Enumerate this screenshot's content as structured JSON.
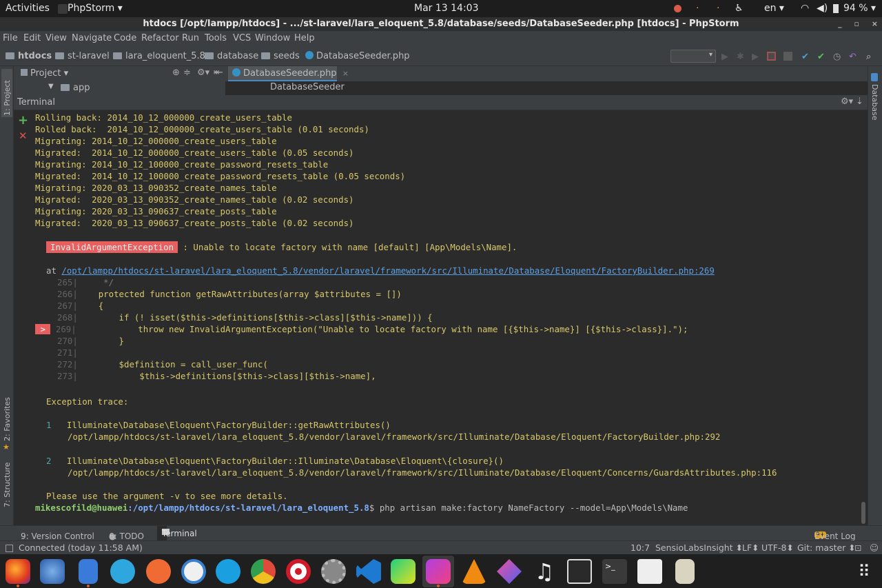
{
  "topbar": {
    "activities": "Activities",
    "app_menu": "PhpStorm ▾",
    "clock": "Mar 13  14:03",
    "lang": "en ▾",
    "battery": "94 % ▾"
  },
  "window": {
    "title": "htdocs [/opt/lampp/htdocs] - .../st-laravel/lara_eloquent_5.8/database/seeds/DatabaseSeeder.php [htdocs] - PhpStorm",
    "min": "_",
    "max": "▫",
    "close": "×"
  },
  "menu": [
    "File",
    "Edit",
    "View",
    "Navigate",
    "Code",
    "Refactor",
    "Run",
    "Tools",
    "VCS",
    "Window",
    "Help"
  ],
  "breadcrumb": [
    "htdocs",
    "st-laravel",
    "lara_eloquent_5.8",
    "database",
    "seeds",
    "DatabaseSeeder.php"
  ],
  "left_strip": {
    "project": "1: Project",
    "favorites": "2: Favorites",
    "structure": "7: Structure"
  },
  "right_strip": {
    "database": "Database"
  },
  "project_panel": {
    "title": "Project ▾",
    "tree_item": "app"
  },
  "editor": {
    "tab": "DatabaseSeeder.php",
    "crumb": "DatabaseSeeder"
  },
  "terminal": {
    "title": "Terminal",
    "lines": [
      {
        "label": "Rolling back: ",
        "text": "2014_10_12_000000_create_users_table"
      },
      {
        "label": "Rolled back:  ",
        "text": "2014_10_12_000000_create_users_table (0.01 seconds)"
      },
      {
        "label": "Migrating: ",
        "text": "2014_10_12_000000_create_users_table"
      },
      {
        "label": "Migrated:  ",
        "text": "2014_10_12_000000_create_users_table (0.05 seconds)"
      },
      {
        "label": "Migrating: ",
        "text": "2014_10_12_100000_create_password_resets_table"
      },
      {
        "label": "Migrated:  ",
        "text": "2014_10_12_100000_create_password_resets_table (0.05 seconds)"
      },
      {
        "label": "Migrating: ",
        "text": "2020_03_13_090352_create_names_table"
      },
      {
        "label": "Migrated:  ",
        "text": "2020_03_13_090352_create_names_table (0.02 seconds)"
      },
      {
        "label": "Migrating: ",
        "text": "2020_03_13_090637_create_posts_table"
      },
      {
        "label": "Migrated:  ",
        "text": "2020_03_13_090637_create_posts_table (0.02 seconds)"
      }
    ],
    "exception_name": "InvalidArgumentException",
    "exception_msg": " : Unable to locate factory with name [default] [App\\Models\\Name].",
    "at_label": "at ",
    "at_path": "/opt/lampp/htdocs/st-laravel/lara_eloquent_5.8/vendor/laravel/framework/src/Illuminate/Database/Eloquent/FactoryBuilder.php:269",
    "code_lines": [
      {
        "num": "265",
        "code": "     */"
      },
      {
        "num": "266",
        "code": "    protected function getRawAttributes(array $attributes = [])"
      },
      {
        "num": "267",
        "code": "    {"
      },
      {
        "num": "268",
        "code": "        if (! isset($this->definitions[$this->class][$this->name])) {"
      },
      {
        "num": "269",
        "code": "            throw new InvalidArgumentException(\"Unable to locate factory with name [{$this->name}] [{$this->class}].\");"
      },
      {
        "num": "270",
        "code": "        }"
      },
      {
        "num": "271",
        "code": ""
      },
      {
        "num": "272",
        "code": "        $definition = call_user_func("
      },
      {
        "num": "273",
        "code": "            $this->definitions[$this->class][$this->name],"
      }
    ],
    "marker": " > ",
    "trace_title": "Exception trace:",
    "trace": [
      {
        "n": "1",
        "fn": "Illuminate\\Database\\Eloquent\\FactoryBuilder::getRawAttributes()",
        "path": "/opt/lampp/htdocs/st-laravel/lara_eloquent_5.8/vendor/laravel/framework/src/Illuminate/Database/Eloquent/FactoryBuilder.php:292"
      },
      {
        "n": "2",
        "fn": "Illuminate\\Database\\Eloquent\\FactoryBuilder::Illuminate\\Database\\Eloquent\\{closure}()",
        "path": "/opt/lampp/htdocs/st-laravel/lara_eloquent_5.8/vendor/laravel/framework/src/Illuminate/Database/Eloquent/Concerns/GuardsAttributes.php:116"
      }
    ],
    "hint": "Please use the argument -v to see more details.",
    "prompt_user": "mikescofild@huawei",
    "prompt_path": ":/opt/lampp/htdocs/st-laravel/lara_eloquent_5.8",
    "prompt_cmd": "$ php artisan make:factory NameFactory --model=App\\Models\\Name"
  },
  "bottom_tabs": {
    "vc": "9: Version Control",
    "todo": "6: TODO",
    "terminal": "Terminal",
    "events": "Event Log",
    "events_badge": "9+"
  },
  "status": {
    "connected": "Connected (today 11:58 AM)",
    "pos": "10:7",
    "insight": "SensioLabsInsight ⬍",
    "lf": "LF⬍",
    "enc": "UTF-8⬍",
    "git": "Git: master ⬍"
  },
  "dock": [
    "Firefox",
    "Thunderbird",
    "Text Editor",
    "Telegram",
    "Postman",
    "Simplenote",
    "Skype",
    "Chrome",
    "Opera",
    "Settings",
    "VS Code",
    "PyCharm",
    "PhpStorm",
    "VLC",
    "Kite",
    "Music",
    "System Monitor",
    "Terminal",
    "Image Viewer",
    "Notes",
    "Show Applications"
  ],
  "colors": {
    "accent": "#4a88c7",
    "error": "#e85f5f",
    "migrate": "#d8c86b",
    "prompt_user": "#8fcf6f",
    "prompt_path": "#7eb0ff"
  }
}
